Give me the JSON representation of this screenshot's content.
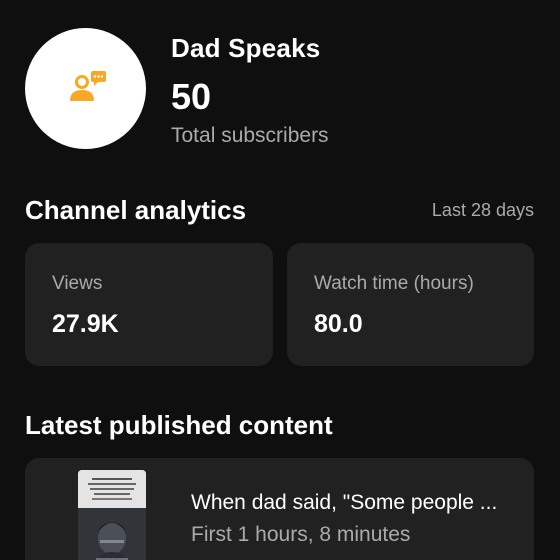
{
  "channel": {
    "name": "Dad Speaks",
    "subscriber_count": "50",
    "subscriber_label": "Total subscribers",
    "avatar_icon": "person-speech-bubble-icon",
    "avatar_color": "#f9a825"
  },
  "analytics": {
    "title": "Channel analytics",
    "period": "Last 28 days",
    "cards": [
      {
        "label": "Views",
        "value": "27.9K"
      },
      {
        "label": "Watch time (hours)",
        "value": "80.0"
      }
    ]
  },
  "latest": {
    "title": "Latest published content",
    "video": {
      "title": "When dad said, \"Some people ...",
      "meta": "First 1 hours, 8 minutes"
    }
  },
  "colors": {
    "background": "#0f0f0f",
    "card": "#212121",
    "primary_text": "#ffffff",
    "secondary_text": "#aaaaaa"
  }
}
